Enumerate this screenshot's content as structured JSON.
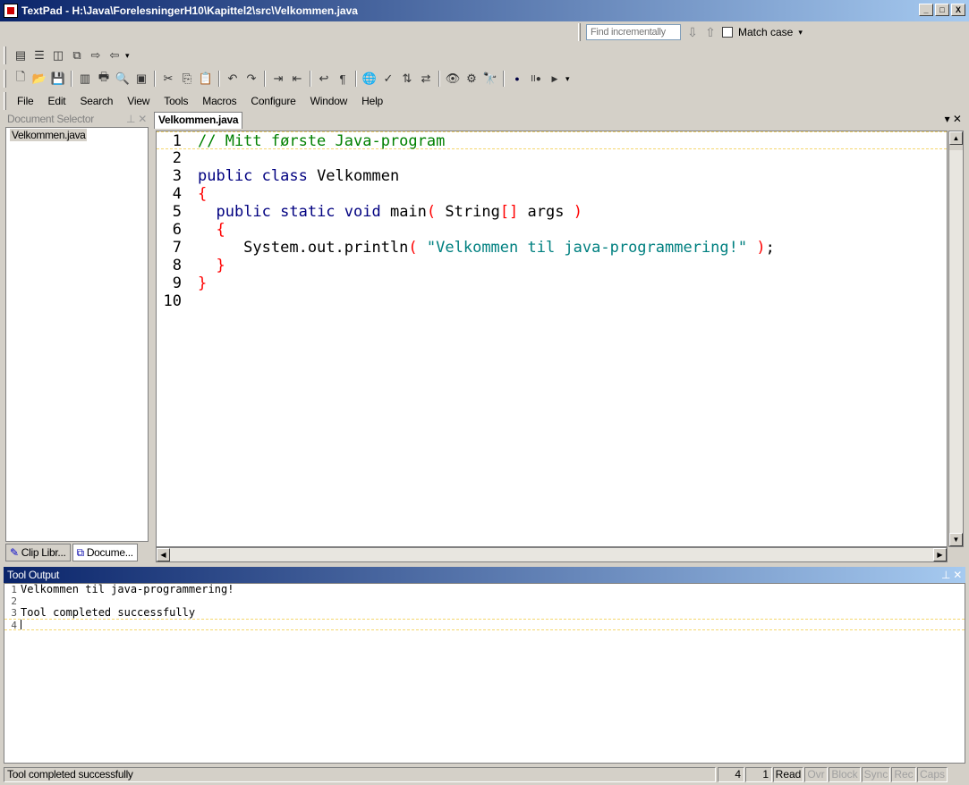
{
  "window": {
    "title": "TextPad - H:\\Java\\ForelesningerH10\\Kapittel2\\src\\Velkommen.java",
    "btn_min": "_",
    "btn_max": "□",
    "btn_close": "X"
  },
  "find": {
    "placeholder": "Find incrementally",
    "down_icon": "arrow-down-icon",
    "up_icon": "arrow-up-icon",
    "match_case": "Match case",
    "checked": false
  },
  "menu": [
    "File",
    "Edit",
    "Search",
    "View",
    "Tools",
    "Macros",
    "Configure",
    "Window",
    "Help"
  ],
  "doc_selector": {
    "title": "Document Selector",
    "items": [
      "Velkommen.java"
    ],
    "tabs": [
      "Clip Libr...",
      "Docume..."
    ]
  },
  "editor": {
    "tab": "Velkommen.java",
    "lines": [
      {
        "n": "1",
        "html": "<span class='cm'>// Mitt første Java-program</span>"
      },
      {
        "n": "2",
        "html": ""
      },
      {
        "n": "3",
        "html": "<span class='kw'>public class</span> Velkommen"
      },
      {
        "n": "4",
        "html": "<span class='br'>{</span>"
      },
      {
        "n": "5",
        "html": "  <span class='kw'>public static void</span> main<span class='br'>(</span> String<span class='br'>[]</span> args <span class='br'>)</span>"
      },
      {
        "n": "6",
        "html": "  <span class='br'>{</span>"
      },
      {
        "n": "7",
        "html": "     System.out.println<span class='br'>(</span> <span class='str'>\"Velkommen til java-programmering!\"</span> <span class='br'>)</span>;"
      },
      {
        "n": "8",
        "html": "  <span class='br'>}</span>"
      },
      {
        "n": "9",
        "html": "<span class='br'>}</span>"
      },
      {
        "n": "10",
        "html": ""
      }
    ]
  },
  "tool_output": {
    "title": "Tool Output",
    "lines": [
      {
        "n": "1",
        "text": "Velkommen til java-programmering!"
      },
      {
        "n": "2",
        "text": ""
      },
      {
        "n": "3",
        "text": "Tool completed successfully"
      },
      {
        "n": "4",
        "text": ""
      }
    ]
  },
  "status": {
    "message": "Tool completed successfully",
    "line": "4",
    "col": "1",
    "read": "Read",
    "ovr": "Ovr",
    "block": "Block",
    "sync": "Sync",
    "rec": "Rec",
    "caps": "Caps"
  }
}
